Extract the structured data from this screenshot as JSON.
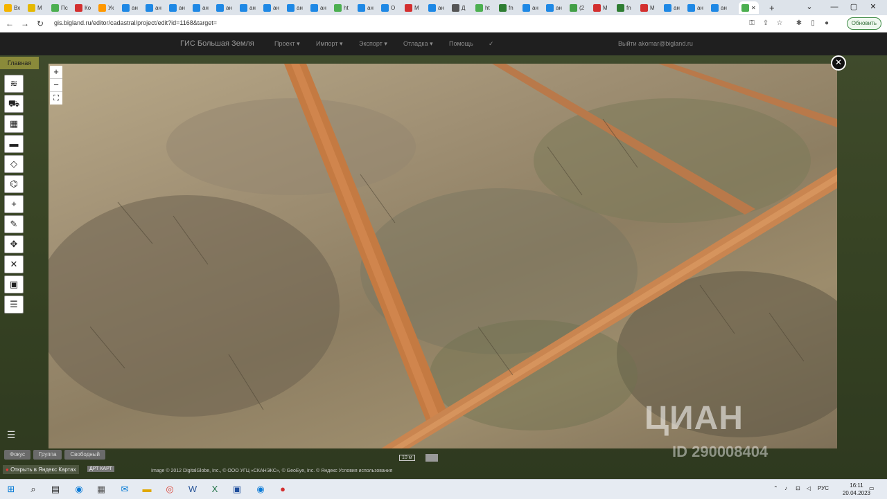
{
  "browser": {
    "tabs": [
      {
        "label": "Вх",
        "color": "#f4b400"
      },
      {
        "label": "М",
        "color": "#e5b800"
      },
      {
        "label": "Пс",
        "color": "#4caf50"
      },
      {
        "label": "Ко",
        "color": "#d32f2f"
      },
      {
        "label": "Ук",
        "color": "#ff9800"
      },
      {
        "label": "ан",
        "color": "#1e88e5"
      },
      {
        "label": "ан",
        "color": "#1e88e5"
      },
      {
        "label": "ан",
        "color": "#1e88e5"
      },
      {
        "label": "ан",
        "color": "#1e88e5"
      },
      {
        "label": "ан",
        "color": "#1e88e5"
      },
      {
        "label": "ан",
        "color": "#1e88e5"
      },
      {
        "label": "ан",
        "color": "#1e88e5"
      },
      {
        "label": "ан",
        "color": "#1e88e5"
      },
      {
        "label": "ан",
        "color": "#1e88e5"
      },
      {
        "label": "ht",
        "color": "#4caf50"
      },
      {
        "label": "ан",
        "color": "#1e88e5"
      },
      {
        "label": "О",
        "color": "#1e88e5"
      },
      {
        "label": "М",
        "color": "#d32f2f"
      },
      {
        "label": "ан",
        "color": "#1e88e5"
      },
      {
        "label": "Д",
        "color": "#555555"
      },
      {
        "label": "ht",
        "color": "#4caf50"
      },
      {
        "label": "fn",
        "color": "#2e7d32"
      },
      {
        "label": "ан",
        "color": "#1e88e5"
      },
      {
        "label": "ан",
        "color": "#1e88e5"
      },
      {
        "label": "(2",
        "color": "#43a047"
      },
      {
        "label": "М",
        "color": "#d32f2f"
      },
      {
        "label": "fn",
        "color": "#2e7d32"
      },
      {
        "label": "М",
        "color": "#d32f2f"
      },
      {
        "label": "ан",
        "color": "#1e88e5"
      },
      {
        "label": "ан",
        "color": "#1e88e5"
      },
      {
        "label": "ан",
        "color": "#1e88e5"
      }
    ],
    "active_tab_close": "✕",
    "new_tab": "+",
    "url": "gis.bigland.ru/editor/cadastral/project/edit?id=1168&target=",
    "update_label": "Обновить"
  },
  "app": {
    "brand": "ГИС Большая Земля",
    "menu": [
      "Проект ▾",
      "Импорт ▾",
      "Экспорт ▾",
      "Отладка ▾",
      "Помощь"
    ],
    "check": "✓",
    "user": "Выйти akomar@bigland.ru",
    "home_tab": "Главная"
  },
  "map": {
    "mode_buttons": [
      "Фокус",
      "Группа",
      "Свободный"
    ],
    "yandex_link": "Открыть в Яндекс Картах",
    "dpt_label": "ДРТ КАРТ",
    "copyright": "Image © 2012 DigitalGlobe, Inc., © ООО УГЦ «СКАНЭКС», © GeoEye, Inc. © Яндекс Условия использования",
    "scale": "10 м"
  },
  "photo": {
    "zoom_in": "+",
    "zoom_out": "−",
    "fullscreen": "⛶",
    "close": "✕",
    "watermark_logo": "ЦИАН",
    "watermark_id": "ID 290008404"
  },
  "taskbar": {
    "language": "РУС",
    "time": "16:11",
    "date": "20.04.2023"
  }
}
